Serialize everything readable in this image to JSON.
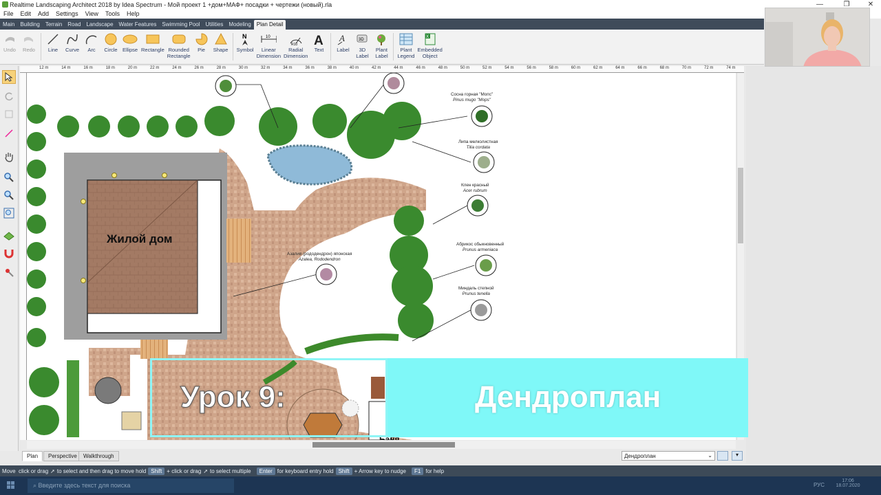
{
  "window": {
    "title": "Realtime Landscaping Architect 2018 by Idea Spectrum - Мой проект 1 +дом+МАФ+ посадки + чертежи (новый).rla",
    "controls": [
      "—",
      "❐",
      "✕"
    ]
  },
  "menu": [
    "File",
    "Edit",
    "Add",
    "Settings",
    "View",
    "Tools",
    "Help"
  ],
  "ribbon_tabs": [
    "Main",
    "Building",
    "Terrain",
    "Road",
    "Landscape",
    "Water Features",
    "Swimming Pool",
    "Utilities",
    "Modeling",
    "Plan Detail"
  ],
  "active_tab": "Plan Detail",
  "toolbar": {
    "undo": "Undo",
    "redo": "Redo",
    "line": "Line",
    "curve": "Curve",
    "arc": "Arc",
    "circle": "Circle",
    "ellipse": "Ellipse",
    "rectangle": "Rectangle",
    "rounded_rectangle": "Rounded\nRectangle",
    "pie": "Pie",
    "shape": "Shape",
    "symbol": "Symbol",
    "linear_dimension": "Linear\nDimension",
    "radial_dimension": "Radial\nDimension",
    "text": "Text",
    "label": "Label",
    "label_3d": "3D\nLabel",
    "plant_label": "Plant\nLabel",
    "plant_legend": "Plant\nLegend",
    "embedded_object": "Embedded\nObject"
  },
  "ruler_labels": [
    "12 m",
    "14 m",
    "16 m",
    "18 m",
    "20 m",
    "22 m",
    "24 m",
    "26 m",
    "28 m",
    "30 m",
    "32 m",
    "34 m",
    "36 m",
    "38 m",
    "40 m",
    "42 m",
    "44 m",
    "46 m",
    "48 m",
    "50 m",
    "52 m",
    "54 m",
    "56 m",
    "58 m",
    "60 m",
    "62 m",
    "64 m",
    "66 m",
    "68 m",
    "70 m",
    "72 m",
    "74 m"
  ],
  "plan": {
    "house_label": "Жилой дом",
    "bath_label": "Баня",
    "plants": [
      {
        "ru": "Сосна горная \"Мопс\"",
        "lat": "Pinus mugo \"Mops\""
      },
      {
        "ru": "Липа мелколистная",
        "lat": "Tilia cordata"
      },
      {
        "ru": "Клен красный",
        "lat": "Acer rubrum"
      },
      {
        "ru": "Абрикос обыкновенный",
        "lat": "Prunus armeniaca"
      },
      {
        "ru": "Миндаль степной",
        "lat": "Prunus tenella"
      },
      {
        "ru": "Азалия (рододендрон) японская",
        "lat": "Azalea, Rododendron"
      }
    ]
  },
  "view_tabs": [
    "Plan",
    "Perspective",
    "Walkthrough"
  ],
  "active_view": "Plan",
  "layer_select": "Дендроплан",
  "status": {
    "mode": "Move",
    "hint1": "click or drag",
    "hint2": "to select and then drag to move",
    "hold": "hold",
    "key_shift": "Shift",
    "hint3": "+ click or drag",
    "hint4": "to select multiple",
    "key_enter": "Enter",
    "hint5": "for keyboard entry",
    "hold2": "hold",
    "key_shift2": "Shift",
    "hint6": "+ Arrow key to nudge",
    "key_f1": "F1",
    "hint7": "for help"
  },
  "taskbar": {
    "search_placeholder": "Введите здесь текст для поиска",
    "lang": "РУС",
    "time": "17:06",
    "date": "18.07.2020"
  },
  "overlay": {
    "lesson": "Урок 9:",
    "topic": "Дендроплан"
  }
}
